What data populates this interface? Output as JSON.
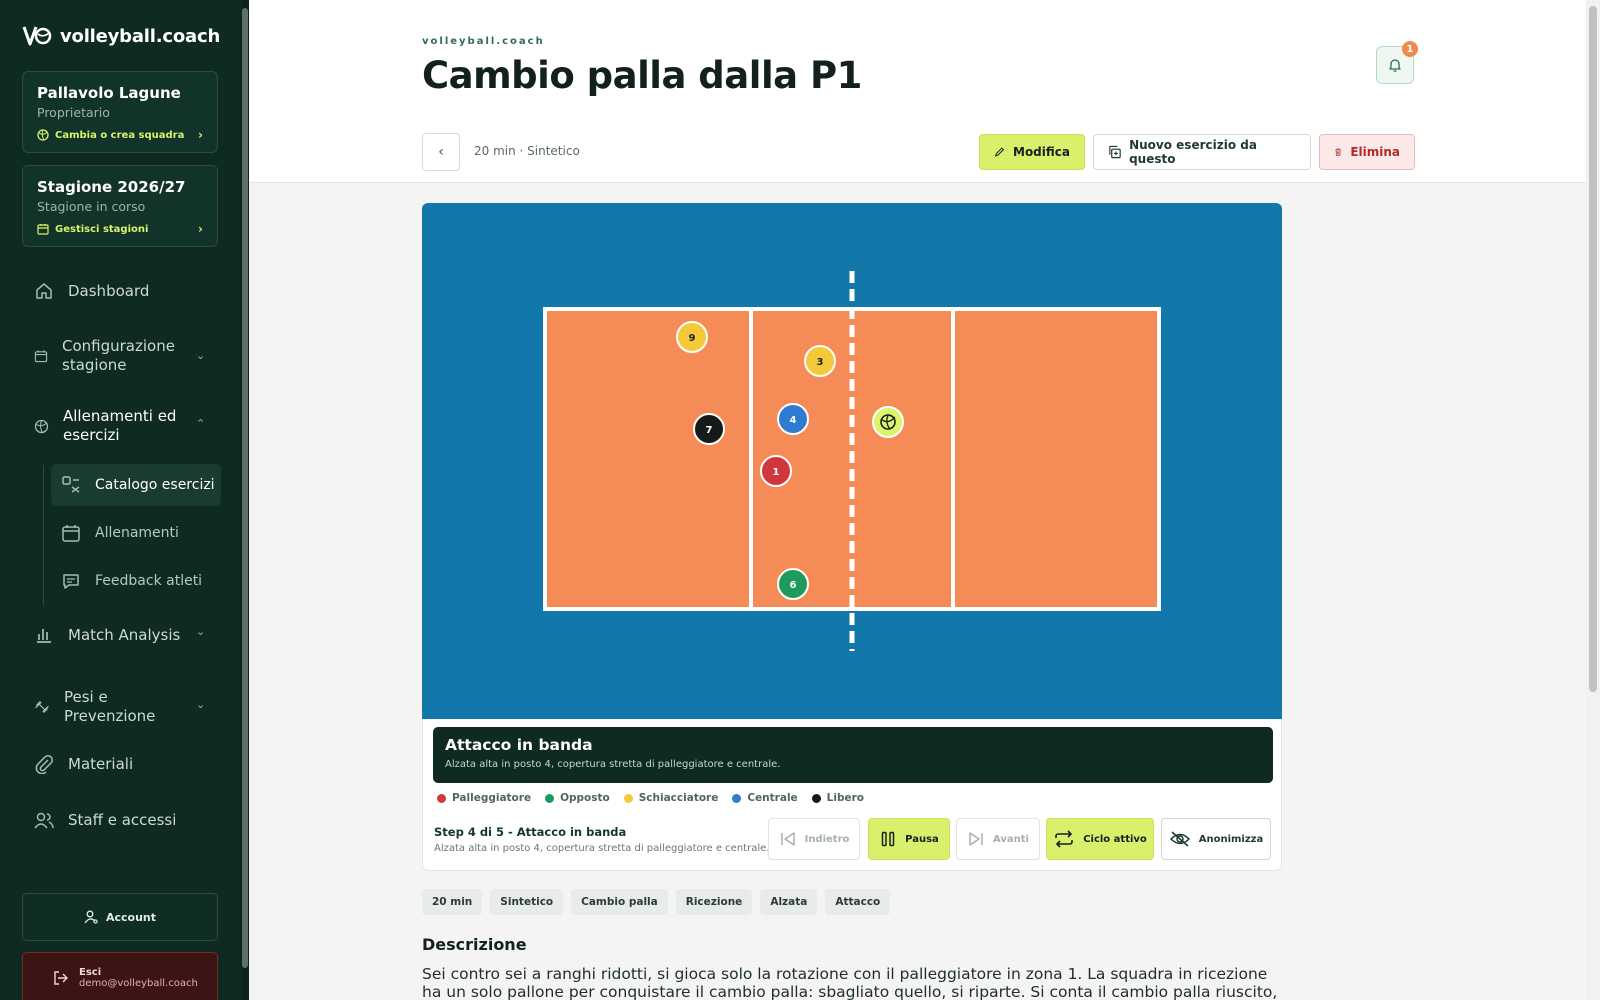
{
  "app": {
    "logo_text": "volleyball.coach"
  },
  "team_card": {
    "name": "Pallavolo Lagune",
    "role": "Proprietario",
    "link": "Cambia o crea squadra"
  },
  "season_card": {
    "name": "Stagione 2026/27",
    "status": "Stagione in corso",
    "link": "Gestisci stagioni"
  },
  "nav": {
    "dashboard": "Dashboard",
    "config": [
      "Configurazione",
      "stagione"
    ],
    "training": [
      "Allenamenti ed",
      "esercizi"
    ],
    "catalog": "Catalogo esercizi",
    "sessions": "Allenamenti",
    "feedback": "Feedback atleti",
    "match": "Match Analysis",
    "weights": [
      "Pesi e",
      "Prevenzione"
    ],
    "materials": "Materiali",
    "staff": "Staff e accessi"
  },
  "account": {
    "label": "Account",
    "logout_label": "Esci",
    "email": "demo@volleyball.coach"
  },
  "header": {
    "kicker": "volleyball.coach",
    "title": "Cambio palla dalla P1",
    "notifications": "1",
    "meta": "20 min · Sintetico",
    "edit": "Modifica",
    "new_from": "Nuovo esercizio da questo",
    "delete": "Elimina"
  },
  "court": {
    "players": [
      {
        "label": "9",
        "color": "#f5c93a",
        "text": "#14231d",
        "x": 0.0,
        "y": 0.0
      },
      {
        "label": "3",
        "color": "#f5c93a",
        "text": "#14231d"
      },
      {
        "label": "7",
        "color": "#151b18",
        "text": "#ffffff"
      },
      {
        "label": "4",
        "color": "#2f7bd0",
        "text": "#ffffff"
      },
      {
        "label": "1",
        "color": "#d0373d",
        "text": "#ffffff"
      },
      {
        "label": "6",
        "color": "#1f9a5c",
        "text": "#ffffff"
      }
    ]
  },
  "step": {
    "title": "Attacco in banda",
    "description": "Alzata alta in posto 4, copertura stretta di palleggiatore e centrale.",
    "counter": "Step 4 di 5 - Attacco in banda"
  },
  "legend": [
    {
      "label": "Palleggiatore",
      "color": "#d0373d"
    },
    {
      "label": "Opposto",
      "color": "#1f9a5c"
    },
    {
      "label": "Schiacciatore",
      "color": "#f5c93a"
    },
    {
      "label": "Centrale",
      "color": "#2f7bd0"
    },
    {
      "label": "Libero",
      "color": "#151b18"
    }
  ],
  "controls": {
    "back": "Indietro",
    "pause": "Pausa",
    "forward": "Avanti",
    "loop": "Ciclo attivo",
    "anon": "Anonimizza"
  },
  "tags": [
    "20 min",
    "Sintetico",
    "Cambio palla",
    "Ricezione",
    "Alzata",
    "Attacco"
  ],
  "description": {
    "title": "Descrizione",
    "body": "Sei contro sei a ranghi ridotti, si gioca solo la rotazione con il palleggiatore in zona 1. La squadra in ricezione ha un solo pallone per conquistare il cambio palla: sbagliato quello, si riparte. Si conta il cambio palla riuscito, non il punto: un"
  },
  "colors": {
    "sidebar_bg": "#0e2a22",
    "accent": "#d8f06b",
    "court_bg": "#1278aa",
    "court_floor": "#f58b57",
    "danger": "#b42a2a"
  }
}
